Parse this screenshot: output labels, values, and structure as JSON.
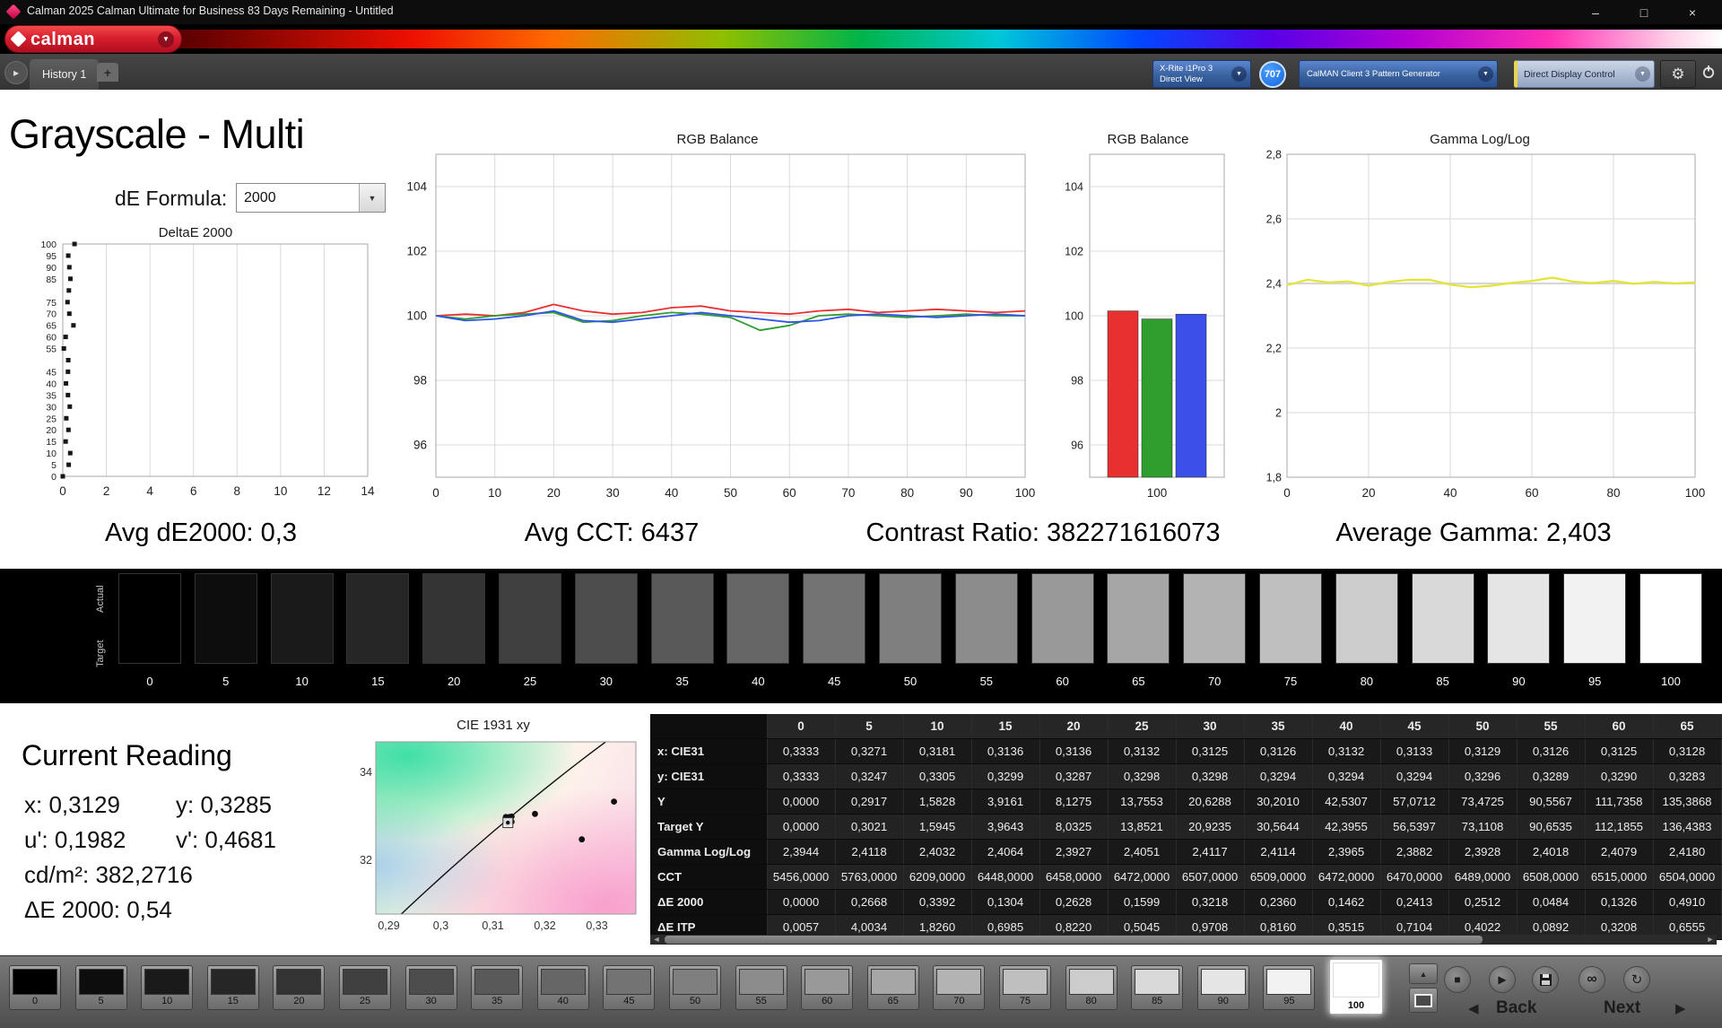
{
  "title_bar": {
    "title": "Calman 2025 Calman Ultimate for Business 83 Days Remaining  - Untitled",
    "minimize": "–",
    "maximize": "□",
    "close": "×"
  },
  "logo": {
    "text": "calman",
    "arrow": "▼"
  },
  "tab_bar": {
    "nav_arrow": "▸",
    "tab_label": "History 1",
    "add_label": "+",
    "meter": {
      "line1": "X-Rite i1Pro 3",
      "line2": "Direct View",
      "arrow": "▼"
    },
    "badge": "707",
    "pattern": {
      "label": "CalMAN Client 3 Pattern Generator",
      "arrow": "▼"
    },
    "display": {
      "label": "Direct Display Control",
      "arrow": "▼"
    },
    "gear": "⚙"
  },
  "page": {
    "title": "Grayscale - Multi",
    "de_formula_label": "dE Formula:",
    "de_formula_value": "2000"
  },
  "stats": [
    "Avg dE2000: 0,3",
    "Avg CCT: 6437",
    "Contrast Ratio: 382271616073",
    "Average Gamma: 2,403"
  ],
  "grayscale_strip": {
    "row_label_top": "Actual",
    "row_label_bottom": "Target",
    "levels": [
      "0",
      "5",
      "10",
      "15",
      "20",
      "25",
      "30",
      "35",
      "40",
      "45",
      "50",
      "55",
      "60",
      "65",
      "70",
      "75",
      "80",
      "85",
      "90",
      "95",
      "100"
    ]
  },
  "current_reading": {
    "heading": "Current Reading",
    "x": "x: 0,3129",
    "y": "y: 0,3285",
    "u": "u': 0,1982",
    "v": "v': 0,4681",
    "cd": "cd/m²: 382,2716",
    "de": "ΔE 2000: 0,54"
  },
  "table": {
    "headers": [
      "0",
      "5",
      "10",
      "15",
      "20",
      "25",
      "30",
      "35",
      "40",
      "45",
      "50",
      "55",
      "60",
      "65"
    ],
    "rows": [
      {
        "label": "x: CIE31",
        "values": [
          "0,3333",
          "0,3271",
          "0,3181",
          "0,3136",
          "0,3136",
          "0,3132",
          "0,3125",
          "0,3126",
          "0,3132",
          "0,3133",
          "0,3129",
          "0,3126",
          "0,3125",
          "0,3128"
        ]
      },
      {
        "label": "y: CIE31",
        "values": [
          "0,3333",
          "0,3247",
          "0,3305",
          "0,3299",
          "0,3287",
          "0,3298",
          "0,3298",
          "0,3294",
          "0,3294",
          "0,3294",
          "0,3296",
          "0,3289",
          "0,3290",
          "0,3283"
        ]
      },
      {
        "label": "Y",
        "values": [
          "0,0000",
          "0,2917",
          "1,5828",
          "3,9161",
          "8,1275",
          "13,7553",
          "20,6288",
          "30,2010",
          "42,5307",
          "57,0712",
          "73,4725",
          "90,5567",
          "111,7358",
          "135,3868"
        ]
      },
      {
        "label": "Target Y",
        "values": [
          "0,0000",
          "0,3021",
          "1,5945",
          "3,9643",
          "8,0325",
          "13,8521",
          "20,9235",
          "30,5644",
          "42,3955",
          "56,5397",
          "73,1108",
          "90,6535",
          "112,1855",
          "136,4383"
        ]
      },
      {
        "label": "Gamma Log/Log",
        "values": [
          "2,3944",
          "2,4118",
          "2,4032",
          "2,4064",
          "2,3927",
          "2,4051",
          "2,4117",
          "2,4114",
          "2,3965",
          "2,3882",
          "2,3928",
          "2,4018",
          "2,4079",
          "2,4180"
        ]
      },
      {
        "label": "CCT",
        "values": [
          "5456,0000",
          "5763,0000",
          "6209,0000",
          "6448,0000",
          "6458,0000",
          "6472,0000",
          "6507,0000",
          "6509,0000",
          "6472,0000",
          "6470,0000",
          "6489,0000",
          "6508,0000",
          "6515,0000",
          "6504,0000"
        ]
      },
      {
        "label": "ΔE 2000",
        "values": [
          "0,0000",
          "0,2668",
          "0,3392",
          "0,1304",
          "0,2628",
          "0,1599",
          "0,3218",
          "0,2360",
          "0,1462",
          "0,2413",
          "0,2512",
          "0,0484",
          "0,1326",
          "0,4910"
        ]
      },
      {
        "label": "ΔE ITP",
        "values": [
          "0,0057",
          "4,0034",
          "1,8260",
          "0,6985",
          "0,8220",
          "0,5045",
          "0,9708",
          "0,8160",
          "0,3515",
          "0,7104",
          "0,4022",
          "0,0892",
          "0,3208",
          "0,6555"
        ]
      }
    ]
  },
  "bottom_bar": {
    "levels": [
      "0",
      "5",
      "10",
      "15",
      "20",
      "25",
      "30",
      "35",
      "40",
      "45",
      "50",
      "55",
      "60",
      "65",
      "70",
      "75",
      "80",
      "85",
      "90",
      "95",
      "100"
    ],
    "selected": "100",
    "back": "Back",
    "next": "Next",
    "icons": {
      "up": "▲",
      "stop": "■",
      "play": "▶",
      "infinity": "∞",
      "loop": "↻",
      "back_arrow": "◀",
      "next_arrow": "▶"
    }
  },
  "chart_data": [
    {
      "id": "deltae",
      "type": "scatter",
      "title": "DeltaE 2000",
      "xlim": [
        0,
        14
      ],
      "ylim": [
        0,
        100
      ],
      "xticks": [
        0,
        2,
        4,
        6,
        8,
        10,
        12,
        14
      ],
      "yticks": [
        100,
        95,
        90,
        85,
        75,
        70,
        65,
        60,
        55,
        45,
        40,
        35,
        30,
        25,
        20,
        15,
        10,
        5,
        0
      ],
      "point_color": "#161616",
      "points": [
        {
          "x": 0.0,
          "y": 0
        },
        {
          "x": 0.27,
          "y": 5
        },
        {
          "x": 0.34,
          "y": 10
        },
        {
          "x": 0.13,
          "y": 15
        },
        {
          "x": 0.26,
          "y": 20
        },
        {
          "x": 0.16,
          "y": 25
        },
        {
          "x": 0.32,
          "y": 30
        },
        {
          "x": 0.24,
          "y": 35
        },
        {
          "x": 0.15,
          "y": 40
        },
        {
          "x": 0.24,
          "y": 45
        },
        {
          "x": 0.25,
          "y": 50
        },
        {
          "x": 0.05,
          "y": 55
        },
        {
          "x": 0.13,
          "y": 60
        },
        {
          "x": 0.49,
          "y": 65
        },
        {
          "x": 0.3,
          "y": 70
        },
        {
          "x": 0.22,
          "y": 75
        },
        {
          "x": 0.28,
          "y": 80
        },
        {
          "x": 0.35,
          "y": 85
        },
        {
          "x": 0.3,
          "y": 90
        },
        {
          "x": 0.25,
          "y": 95
        },
        {
          "x": 0.54,
          "y": 100
        }
      ]
    },
    {
      "id": "rgb_line",
      "type": "line",
      "title": "RGB Balance",
      "x": [
        0,
        5,
        10,
        15,
        20,
        25,
        30,
        35,
        40,
        45,
        50,
        55,
        60,
        65,
        70,
        75,
        80,
        85,
        90,
        95,
        100
      ],
      "ylim": [
        95,
        105
      ],
      "yticks": [
        96,
        98,
        100,
        102,
        104
      ],
      "xticks": [
        0,
        10,
        20,
        30,
        40,
        50,
        60,
        70,
        80,
        90,
        100
      ],
      "series": [
        {
          "name": "Red",
          "color": "#e83030",
          "values": [
            100.0,
            100.05,
            100.0,
            100.1,
            100.35,
            100.15,
            100.05,
            100.1,
            100.25,
            100.3,
            100.15,
            100.1,
            100.05,
            100.15,
            100.2,
            100.1,
            100.15,
            100.2,
            100.15,
            100.1,
            100.15
          ]
        },
        {
          "name": "Green",
          "color": "#2f9e2f",
          "values": [
            100.0,
            99.9,
            100.0,
            100.05,
            100.1,
            99.8,
            99.85,
            100.0,
            100.1,
            100.05,
            99.95,
            99.55,
            99.7,
            100.0,
            100.05,
            100.0,
            99.95,
            100.0,
            100.05,
            100.0,
            100.0
          ]
        },
        {
          "name": "Blue",
          "color": "#2f55e8",
          "values": [
            100.0,
            99.85,
            99.9,
            100.0,
            100.15,
            99.85,
            99.8,
            99.9,
            100.0,
            100.1,
            100.0,
            99.9,
            99.8,
            99.85,
            100.0,
            100.05,
            100.0,
            99.95,
            100.0,
            100.05,
            100.0
          ]
        }
      ]
    },
    {
      "id": "rgb_bars",
      "type": "bar",
      "title": "RGB Balance",
      "ylim": [
        95,
        105
      ],
      "yticks": [
        96,
        98,
        100,
        102,
        104
      ],
      "category_label": "100",
      "bars": [
        {
          "name": "Red",
          "value": 100.15,
          "color": "#e83030"
        },
        {
          "name": "Green",
          "value": 99.9,
          "color": "#2f9e2f"
        },
        {
          "name": "Blue",
          "value": 100.05,
          "color": "#3a50e8"
        }
      ]
    },
    {
      "id": "gamma",
      "type": "line",
      "title": "Gamma Log/Log",
      "x": [
        0,
        5,
        10,
        15,
        20,
        25,
        30,
        35,
        40,
        45,
        50,
        55,
        60,
        65,
        70,
        75,
        80,
        85,
        90,
        95,
        100
      ],
      "ylim": [
        1.8,
        2.8
      ],
      "yticks": [
        2.8,
        2.6,
        2.4,
        2.2,
        2.0,
        1.8
      ],
      "ytick_labels": [
        "2,8",
        "2,6",
        "2,4",
        "2,2",
        "2",
        "1,8"
      ],
      "xticks": [
        0,
        20,
        40,
        60,
        80,
        100
      ],
      "series": [
        {
          "name": "Target",
          "color": "#d6d6d6",
          "width": 2.2,
          "values": [
            2.4,
            2.4,
            2.4,
            2.4,
            2.4,
            2.4,
            2.4,
            2.4,
            2.4,
            2.4,
            2.4,
            2.4,
            2.4,
            2.4,
            2.4,
            2.4,
            2.4,
            2.4,
            2.4,
            2.4,
            2.4
          ]
        },
        {
          "name": "Gamma",
          "color": "#e4e432",
          "width": 2.2,
          "values": [
            2.3944,
            2.4118,
            2.4032,
            2.4064,
            2.3927,
            2.4051,
            2.4117,
            2.4114,
            2.3965,
            2.3882,
            2.3928,
            2.4018,
            2.4079,
            2.418,
            2.406,
            2.401,
            2.408,
            2.399,
            2.405,
            2.4,
            2.403
          ]
        }
      ]
    },
    {
      "id": "cie",
      "type": "scatter",
      "title": "CIE 1931 xy",
      "xlim": [
        0.2875,
        0.3375
      ],
      "ylim": [
        0.3077,
        0.3469
      ],
      "xticks": [
        0.29,
        0.3,
        0.31,
        0.32,
        0.33
      ],
      "xtick_labels": [
        "0,29",
        "0,3",
        "0,31",
        "0,32",
        "0,33"
      ],
      "yticks": [
        0.34,
        0.32
      ],
      "ytick_labels": [
        "0,34",
        "0,32"
      ],
      "points": [
        {
          "x": 0.3333,
          "y": 0.3333
        },
        {
          "x": 0.3271,
          "y": 0.3247
        },
        {
          "x": 0.3181,
          "y": 0.3305
        },
        {
          "x": 0.3136,
          "y": 0.3299
        },
        {
          "x": 0.3136,
          "y": 0.3287
        },
        {
          "x": 0.3132,
          "y": 0.3298
        },
        {
          "x": 0.3125,
          "y": 0.3298
        },
        {
          "x": 0.3126,
          "y": 0.3294
        },
        {
          "x": 0.3132,
          "y": 0.3294
        },
        {
          "x": 0.3133,
          "y": 0.3294
        },
        {
          "x": 0.3129,
          "y": 0.3296
        },
        {
          "x": 0.3126,
          "y": 0.3289
        },
        {
          "x": 0.3125,
          "y": 0.329
        },
        {
          "x": 0.3128,
          "y": 0.3283
        }
      ],
      "marker": {
        "x": 0.3129,
        "y": 0.3285
      }
    }
  ]
}
